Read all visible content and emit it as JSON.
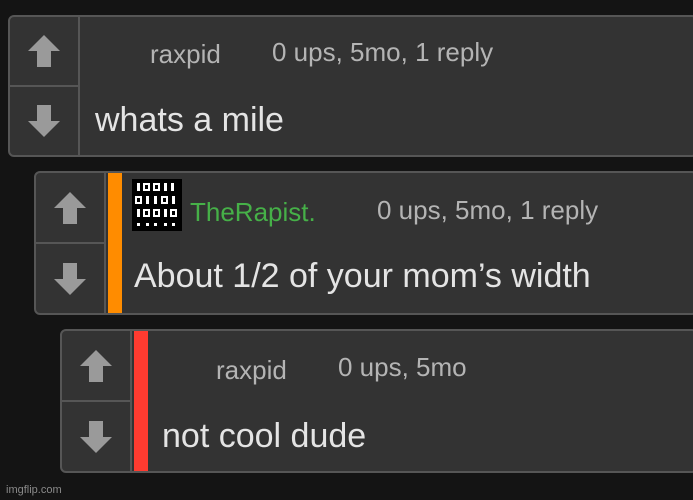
{
  "comments": [
    {
      "username": "raxpid",
      "stats": "0 ups, 5mo, 1 reply",
      "text": "whats a mile",
      "accent_color": null
    },
    {
      "username": "TheRapist.",
      "stats": "0 ups, 5mo, 1 reply",
      "text": "About 1/2 of your mom’s width",
      "accent_color": "#ff8c00",
      "avatar_icon": "binary-code-icon"
    },
    {
      "username": "raxpid",
      "stats": "0 ups, 5mo",
      "text": "not cool dude",
      "accent_color": "#ff3b30"
    }
  ],
  "icons": {
    "upvote": "arrow-up-icon",
    "downvote": "arrow-down-icon"
  },
  "colors": {
    "background": "#141414",
    "panel": "#333333",
    "border": "#565656",
    "username_green": "#46b048"
  },
  "watermark": "imgflip.com"
}
